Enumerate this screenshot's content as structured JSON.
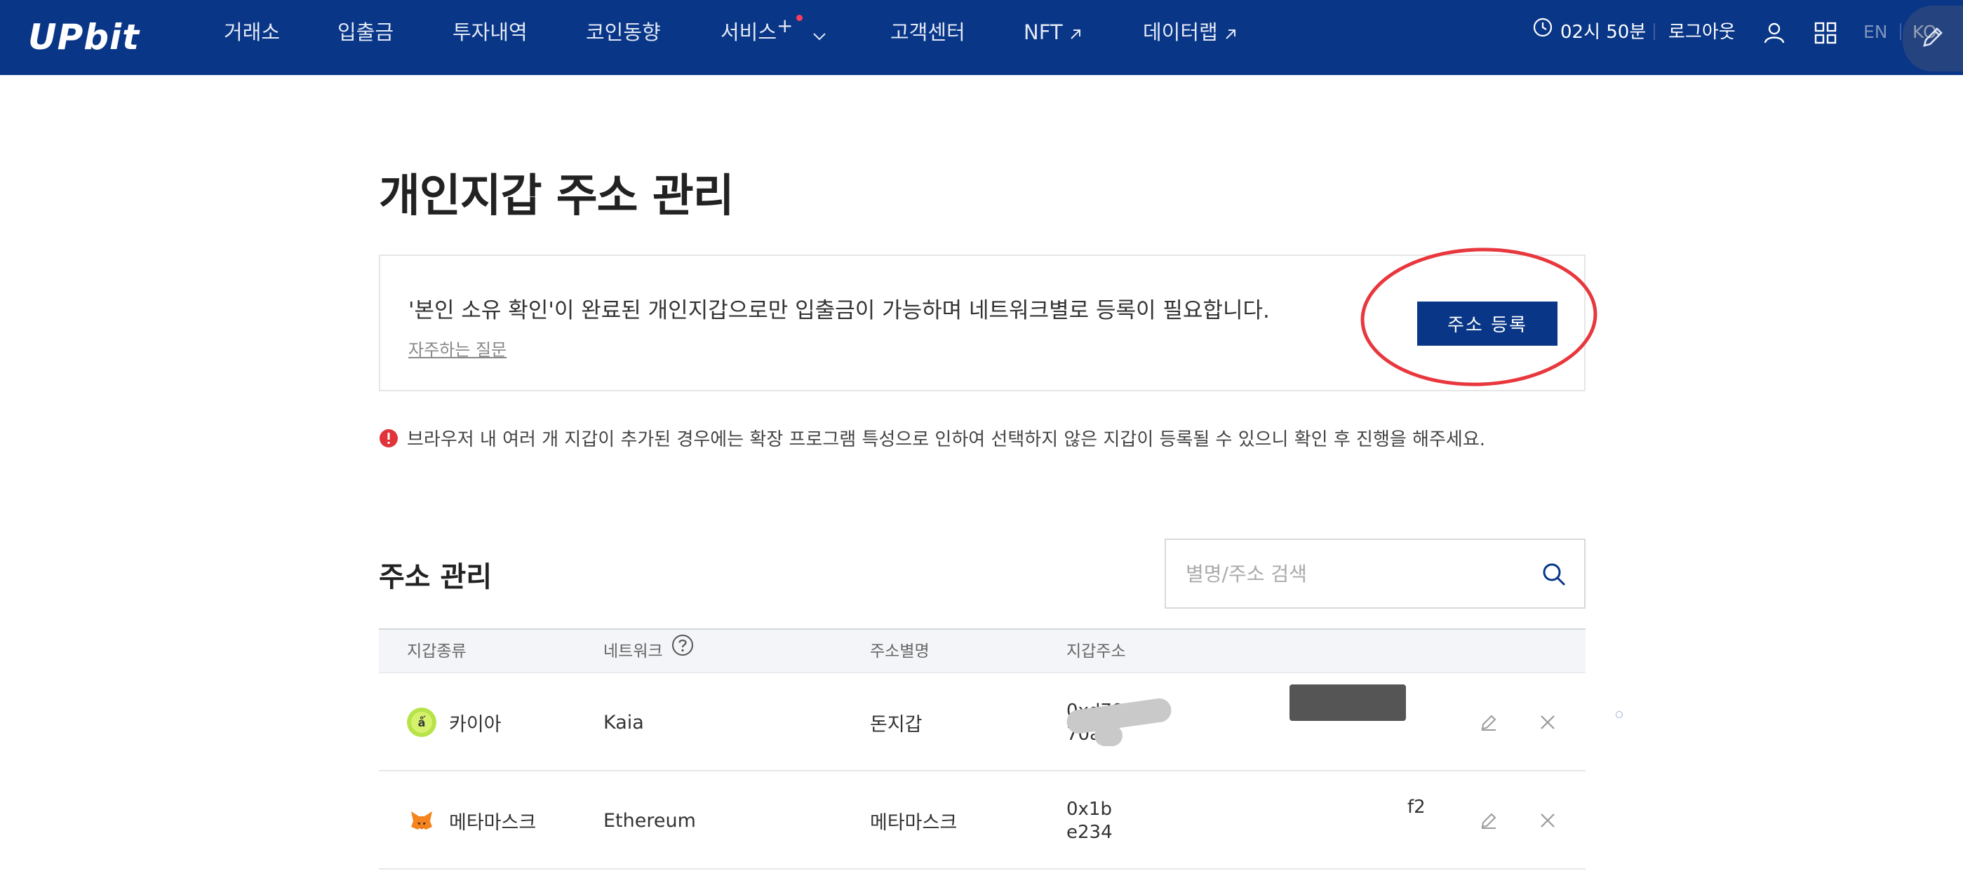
{
  "brand": {
    "logo_text": "UPbit"
  },
  "nav": {
    "items": [
      {
        "label": "거래소"
      },
      {
        "label": "입출금"
      },
      {
        "label": "투자내역"
      },
      {
        "label": "코인동향"
      },
      {
        "label": "서비스",
        "suffix": "+"
      },
      {
        "label": "고객센터"
      },
      {
        "label": "NFT"
      },
      {
        "label": "데이터랩"
      }
    ]
  },
  "header_right": {
    "time": "02시 50분",
    "logout_label": "로그아웃",
    "lang_en": "EN",
    "lang_ko": "KO"
  },
  "page": {
    "title": "개인지갑 주소 관리",
    "notice_text": "'본인 소유 확인'이 완료된 개인지갑으로만 입출금이 가능하며 네트워크별로 등록이 필요합니다.",
    "faq_label": "자주하는 질문",
    "register_label": "주소 등록",
    "warning_text": "브라우저 내 여러 개 지갑이 추가된 경우에는 확장 프로그램 특성으로 인하여 선택하지 않은 지갑이 등록될 수 있으니 확인 후 진행을 해주세요."
  },
  "address_section": {
    "title": "주소 관리",
    "search_placeholder": "별명/주소 검색",
    "columns": [
      "지갑종류",
      "네트워크",
      "주소별명",
      "지갑주소"
    ],
    "rows": [
      {
        "wallet_type": "카이아",
        "network": "Kaia",
        "nickname": "돈지갑",
        "address_line1": "0xd7948512809b5",
        "address_line2": "70a",
        "address_suffix": ""
      },
      {
        "wallet_type": "메타마스크",
        "network": "Ethereum",
        "nickname": "메타마스크",
        "address_line1": "0x1b",
        "address_line2": "e234",
        "address_suffix": "f2"
      }
    ]
  },
  "colors": {
    "brand_blue": "#093687",
    "highlight_red": "#e8373d",
    "warning_red": "#e0333a"
  }
}
